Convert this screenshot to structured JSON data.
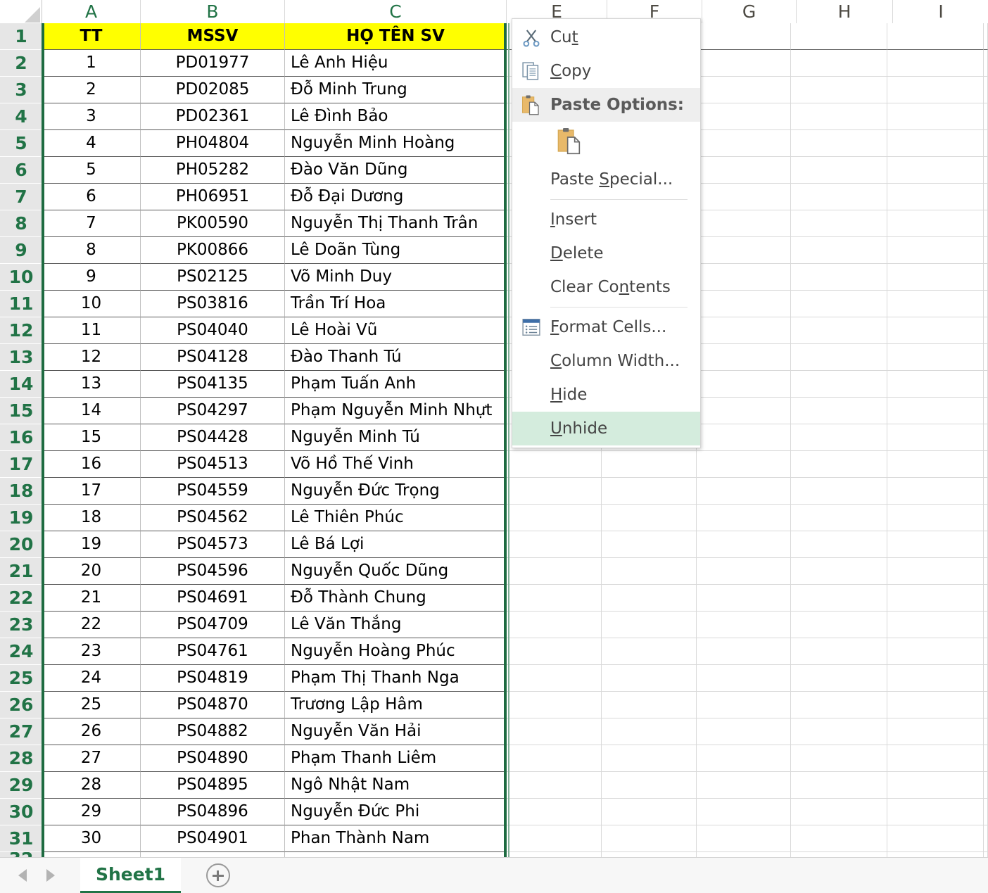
{
  "app": {
    "sheet_tab": "Sheet1",
    "add_sheet_icon": "plus-circle-icon"
  },
  "grid": {
    "column_headers": [
      "A",
      "B",
      "C",
      "E",
      "F",
      "G",
      "H",
      "I"
    ],
    "row_headers": [
      "1",
      "2",
      "3",
      "4",
      "5",
      "6",
      "7",
      "8",
      "9",
      "10",
      "11",
      "12",
      "13",
      "14",
      "15",
      "16",
      "17",
      "18",
      "19",
      "20",
      "21",
      "22",
      "23",
      "24",
      "25",
      "26",
      "27",
      "28",
      "29",
      "30",
      "31"
    ],
    "header_fill": "#ffff00",
    "selection_color": "#1e6b41",
    "table_headers": [
      "TT",
      "MSSV",
      "HỌ TÊN SV"
    ],
    "rows": [
      {
        "tt": "1",
        "mssv": "PD01977",
        "ten": "Lê Anh Hiệu"
      },
      {
        "tt": "2",
        "mssv": "PD02085",
        "ten": "Đỗ Minh Trung"
      },
      {
        "tt": "3",
        "mssv": "PD02361",
        "ten": "Lê Đình Bảo"
      },
      {
        "tt": "4",
        "mssv": "PH04804",
        "ten": "Nguyễn Minh Hoàng"
      },
      {
        "tt": "5",
        "mssv": "PH05282",
        "ten": "Đào Văn Dũng"
      },
      {
        "tt": "6",
        "mssv": "PH06951",
        "ten": "Đỗ Đại Dương"
      },
      {
        "tt": "7",
        "mssv": "PK00590",
        "ten": "Nguyễn Thị Thanh Trân"
      },
      {
        "tt": "8",
        "mssv": "PK00866",
        "ten": "Lê Doãn Tùng"
      },
      {
        "tt": "9",
        "mssv": "PS02125",
        "ten": "Võ Minh Duy"
      },
      {
        "tt": "10",
        "mssv": "PS03816",
        "ten": "Trần Trí Hoa"
      },
      {
        "tt": "11",
        "mssv": "PS04040",
        "ten": "Lê Hoài Vũ"
      },
      {
        "tt": "12",
        "mssv": "PS04128",
        "ten": "Đào Thanh Tú"
      },
      {
        "tt": "13",
        "mssv": "PS04135",
        "ten": "Phạm Tuấn Anh"
      },
      {
        "tt": "14",
        "mssv": "PS04297",
        "ten": "Phạm Nguyễn Minh Nhựt"
      },
      {
        "tt": "15",
        "mssv": "PS04428",
        "ten": "Nguyễn Minh Tú"
      },
      {
        "tt": "16",
        "mssv": "PS04513",
        "ten": "Võ Hồ Thế Vinh"
      },
      {
        "tt": "17",
        "mssv": "PS04559",
        "ten": "Nguyễn Đức Trọng"
      },
      {
        "tt": "18",
        "mssv": "PS04562",
        "ten": "Lê Thiên Phúc"
      },
      {
        "tt": "19",
        "mssv": "PS04573",
        "ten": "Lê Bá Lợi"
      },
      {
        "tt": "20",
        "mssv": "PS04596",
        "ten": "Nguyễn Quốc Dũng"
      },
      {
        "tt": "21",
        "mssv": "PS04691",
        "ten": "Đỗ Thành Chung"
      },
      {
        "tt": "22",
        "mssv": "PS04709",
        "ten": "Lê Văn Thắng"
      },
      {
        "tt": "23",
        "mssv": "PS04761",
        "ten": "Nguyễn Hoàng Phúc"
      },
      {
        "tt": "24",
        "mssv": "PS04819",
        "ten": "Phạm Thị Thanh Nga"
      },
      {
        "tt": "25",
        "mssv": "PS04870",
        "ten": "Trương Lập Hâm"
      },
      {
        "tt": "26",
        "mssv": "PS04882",
        "ten": "Nguyễn Văn Hải"
      },
      {
        "tt": "27",
        "mssv": "PS04890",
        "ten": "Phạm Thanh Liêm"
      },
      {
        "tt": "28",
        "mssv": "PS04895",
        "ten": "Ngô Nhật Nam"
      },
      {
        "tt": "29",
        "mssv": "PS04896",
        "ten": "Nguyễn Đức Phi"
      },
      {
        "tt": "30",
        "mssv": "PS04901",
        "ten": "Phan Thành Nam"
      }
    ]
  },
  "context_menu": {
    "highlight_color": "#d4ecdd",
    "items": [
      {
        "id": "cut",
        "label": "Cut",
        "icon": "scissors-icon",
        "kind": "item"
      },
      {
        "id": "copy",
        "label": "Copy",
        "icon": "copy-icon",
        "kind": "item"
      },
      {
        "id": "paste-options",
        "label": "Paste Options:",
        "icon": "clipboard-icon",
        "kind": "header"
      },
      {
        "id": "paste-gallery",
        "label": "",
        "icon": "paste-keep-source-formatting-icon",
        "kind": "gallery"
      },
      {
        "id": "paste-special",
        "label": "Paste Special...",
        "icon": "",
        "kind": "item"
      },
      {
        "id": "separator-1",
        "label": "",
        "icon": "",
        "kind": "separator"
      },
      {
        "id": "insert",
        "label": "Insert",
        "icon": "",
        "kind": "item"
      },
      {
        "id": "delete",
        "label": "Delete",
        "icon": "",
        "kind": "item"
      },
      {
        "id": "clear-contents",
        "label": "Clear Contents",
        "icon": "",
        "kind": "item"
      },
      {
        "id": "separator-2",
        "label": "",
        "icon": "",
        "kind": "separator"
      },
      {
        "id": "format-cells",
        "label": "Format Cells...",
        "icon": "format-cells-icon",
        "kind": "item"
      },
      {
        "id": "column-width",
        "label": "Column Width...",
        "icon": "",
        "kind": "item"
      },
      {
        "id": "hide",
        "label": "Hide",
        "icon": "",
        "kind": "item"
      },
      {
        "id": "unhide",
        "label": "Unhide",
        "icon": "",
        "kind": "item",
        "selected": true
      }
    ]
  }
}
